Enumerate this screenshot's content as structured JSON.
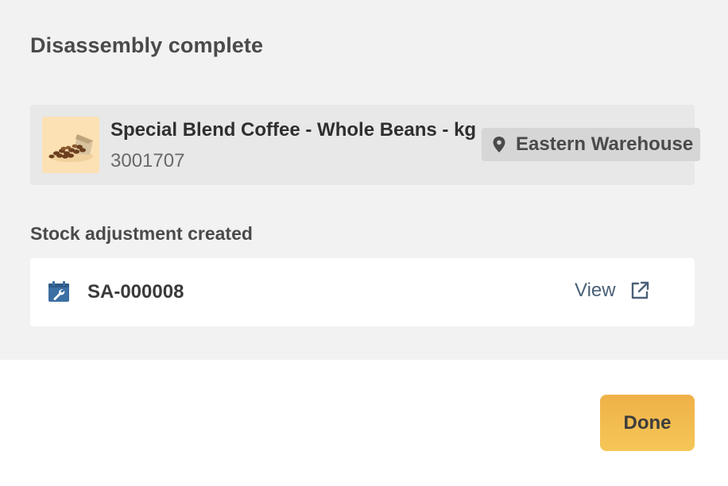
{
  "dialog": {
    "title": "Disassembly complete"
  },
  "product": {
    "name": "Special Blend Coffee - Whole Beans - kg",
    "sku": "3001707",
    "thumbnail_icon": "coffee-beans-image",
    "thumbnail_bg": "#fbe1b3",
    "location": {
      "icon": "map-pin-icon",
      "label": "Eastern Warehouse"
    }
  },
  "stock_adjustment": {
    "heading": "Stock adjustment created",
    "icon": "stock-adjustment-icon",
    "id": "SA-000008",
    "view_label": "View",
    "view_icon": "external-link-icon"
  },
  "footer": {
    "done_label": "Done"
  },
  "colors": {
    "content_bg": "#f2f2f2",
    "product_card_bg": "#e8e8e8",
    "location_badge_bg": "#d6d6d6",
    "link": "#4a6178",
    "adjustment_icon": "#3d6fa3",
    "done_button": "#f2bb50"
  }
}
